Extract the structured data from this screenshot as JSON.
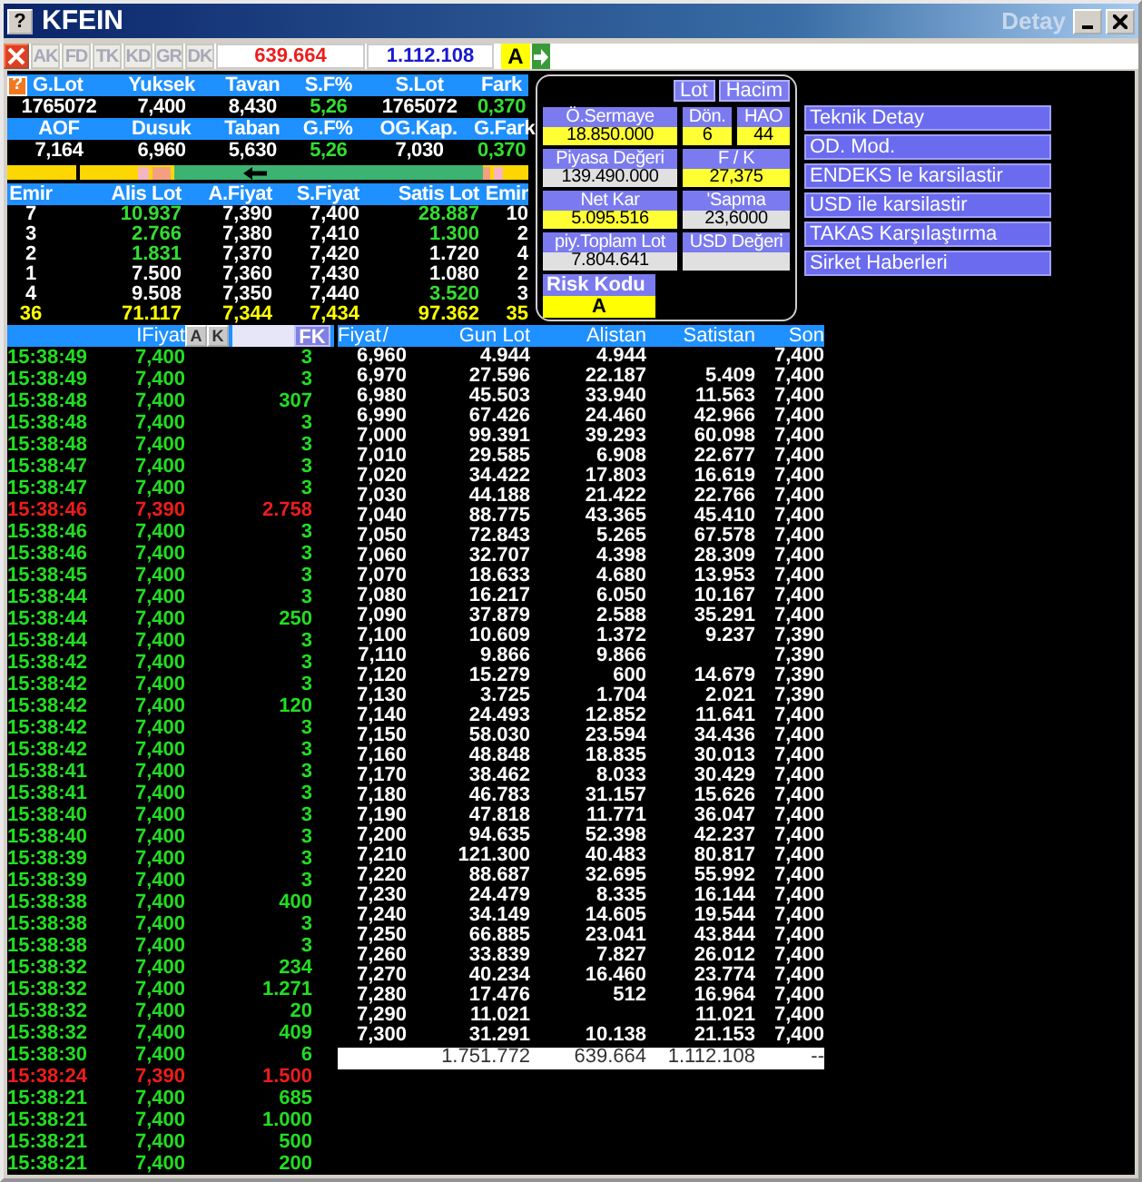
{
  "window": {
    "title": "KFEIN",
    "subtitle": "Detay",
    "help": "?"
  },
  "toolbar": {
    "tabs": [
      {
        "label": "AK",
        "disabled": true
      },
      {
        "label": "FD",
        "disabled": true
      },
      {
        "label": "TK",
        "disabled": true
      },
      {
        "label": "KD",
        "disabled": true
      },
      {
        "label": "GR",
        "disabled": true
      },
      {
        "label": "DK",
        "disabled": true
      }
    ],
    "buy_total": "639.664",
    "sell_total": "1.112.108",
    "risk": "A"
  },
  "stats": {
    "help": "?",
    "rows": [
      {
        "kind": "header",
        "cells": [
          {
            "text": "G.Lot"
          },
          {
            "text": "Yuksek"
          },
          {
            "text": "Tavan"
          },
          {
            "text": "S.F%"
          },
          {
            "text": "S.Lot"
          },
          {
            "text": "Fark"
          }
        ]
      },
      {
        "kind": "values",
        "cells": [
          {
            "text": "1765072",
            "positive": false
          },
          {
            "text": "7,400",
            "positive": false
          },
          {
            "text": "8,430",
            "positive": false
          },
          {
            "text": "5,26",
            "positive": true
          },
          {
            "text": "1765072",
            "positive": false
          },
          {
            "text": "0,370",
            "positive": true
          }
        ]
      },
      {
        "kind": "header",
        "cells": [
          {
            "text": "AOF"
          },
          {
            "text": "Dusuk"
          },
          {
            "text": "Taban"
          },
          {
            "text": "G.F%"
          },
          {
            "text": "OG.Kap."
          },
          {
            "text": "G.Fark"
          }
        ]
      },
      {
        "kind": "values",
        "cells": [
          {
            "text": "7,164",
            "positive": false
          },
          {
            "text": "6,960",
            "positive": false
          },
          {
            "text": "5,630",
            "positive": false
          },
          {
            "text": "5,26",
            "positive": true
          },
          {
            "text": "7,030",
            "positive": false
          },
          {
            "text": "0,370",
            "positive": true
          }
        ]
      }
    ]
  },
  "order_book": {
    "columns": [
      "Emir",
      "Alis Lot",
      "A.Fiyat",
      "S.Fiyat",
      "Satis Lot",
      "Emir"
    ],
    "rows": [
      {
        "bid_orders": "7",
        "bid_lot": "10.937",
        "bid_changed": true,
        "bid": "7,390",
        "ask": "7,400",
        "ask_lot": "28.887",
        "ask_changed": true,
        "ask_orders": "10"
      },
      {
        "bid_orders": "3",
        "bid_lot": "2.766",
        "bid_changed": true,
        "bid": "7,380",
        "ask": "7,410",
        "ask_lot": "1.300",
        "ask_changed": true,
        "ask_orders": "2"
      },
      {
        "bid_orders": "2",
        "bid_lot": "1.831",
        "bid_changed": true,
        "bid": "7,370",
        "ask": "7,420",
        "ask_lot": "1.720",
        "ask_changed": false,
        "ask_orders": "4"
      },
      {
        "bid_orders": "1",
        "bid_lot": "7.500",
        "bid_changed": false,
        "bid": "7,360",
        "ask": "7,430",
        "ask_lot": "1.080",
        "ask_changed": false,
        "ask_orders": "2"
      },
      {
        "bid_orders": "4",
        "bid_lot": "9.508",
        "bid_changed": false,
        "bid": "7,350",
        "ask": "7,440",
        "ask_lot": "3.520",
        "ask_changed": true,
        "ask_orders": "3"
      }
    ],
    "totals": [
      "36",
      "71.117",
      "7,344",
      "7,434",
      "97.362",
      "35"
    ]
  },
  "info_panel": {
    "toggles": [
      {
        "label": "Lot"
      },
      {
        "label": "Hacim"
      }
    ],
    "fields": [
      {
        "label": "Ö.Sermaye",
        "value": "18.850.000",
        "highlight": true
      },
      {
        "label": "Dön.",
        "value": "6",
        "highlight": true
      },
      {
        "label": "HAO",
        "value": "44",
        "highlight": true
      },
      {
        "label": "Piyasa Değeri",
        "value": "139.490.000",
        "highlight": false
      },
      {
        "label": "F / K",
        "value": "27,375",
        "highlight": true
      },
      {
        "label": "Net Kar",
        "value": "5.095.516",
        "highlight": true
      },
      {
        "label": "'Sapma",
        "value": "23,6000",
        "highlight": false
      },
      {
        "label": "piy.Toplam Lot",
        "value": "7.804.641",
        "highlight": false
      },
      {
        "label": "USD Değeri",
        "highlight": false
      }
    ],
    "risk_label": "Risk Kodu",
    "risk_value": "A"
  },
  "actions": [
    "Teknik Detay",
    "OD. Mod.",
    "ENDEKS le karsilastir",
    "USD ile karsilastir",
    "TAKAS Karşılaştırma",
    "Sirket Haberleri"
  ],
  "trades": {
    "header": {
      "price": "IFiyat",
      "buttons": [
        "A",
        "K"
      ],
      "filter": "FK"
    },
    "rows": [
      {
        "time": "15:38:49",
        "price": "7,400",
        "lot": "3",
        "downtick": false
      },
      {
        "time": "15:38:49",
        "price": "7,400",
        "lot": "3",
        "downtick": false
      },
      {
        "time": "15:38:48",
        "price": "7,400",
        "lot": "307",
        "downtick": false
      },
      {
        "time": "15:38:48",
        "price": "7,400",
        "lot": "3",
        "downtick": false
      },
      {
        "time": "15:38:48",
        "price": "7,400",
        "lot": "3",
        "downtick": false
      },
      {
        "time": "15:38:47",
        "price": "7,400",
        "lot": "3",
        "downtick": false
      },
      {
        "time": "15:38:47",
        "price": "7,400",
        "lot": "3",
        "downtick": false
      },
      {
        "time": "15:38:46",
        "price": "7,390",
        "lot": "2.758",
        "downtick": true
      },
      {
        "time": "15:38:46",
        "price": "7,400",
        "lot": "3",
        "downtick": false
      },
      {
        "time": "15:38:46",
        "price": "7,400",
        "lot": "3",
        "downtick": false
      },
      {
        "time": "15:38:45",
        "price": "7,400",
        "lot": "3",
        "downtick": false
      },
      {
        "time": "15:38:44",
        "price": "7,400",
        "lot": "3",
        "downtick": false
      },
      {
        "time": "15:38:44",
        "price": "7,400",
        "lot": "250",
        "downtick": false
      },
      {
        "time": "15:38:44",
        "price": "7,400",
        "lot": "3",
        "downtick": false
      },
      {
        "time": "15:38:42",
        "price": "7,400",
        "lot": "3",
        "downtick": false
      },
      {
        "time": "15:38:42",
        "price": "7,400",
        "lot": "3",
        "downtick": false
      },
      {
        "time": "15:38:42",
        "price": "7,400",
        "lot": "120",
        "downtick": false
      },
      {
        "time": "15:38:42",
        "price": "7,400",
        "lot": "3",
        "downtick": false
      },
      {
        "time": "15:38:42",
        "price": "7,400",
        "lot": "3",
        "downtick": false
      },
      {
        "time": "15:38:41",
        "price": "7,400",
        "lot": "3",
        "downtick": false
      },
      {
        "time": "15:38:41",
        "price": "7,400",
        "lot": "3",
        "downtick": false
      },
      {
        "time": "15:38:40",
        "price": "7,400",
        "lot": "3",
        "downtick": false
      },
      {
        "time": "15:38:40",
        "price": "7,400",
        "lot": "3",
        "downtick": false
      },
      {
        "time": "15:38:39",
        "price": "7,400",
        "lot": "3",
        "downtick": false
      },
      {
        "time": "15:38:39",
        "price": "7,400",
        "lot": "3",
        "downtick": false
      },
      {
        "time": "15:38:38",
        "price": "7,400",
        "lot": "400",
        "downtick": false
      },
      {
        "time": "15:38:38",
        "price": "7,400",
        "lot": "3",
        "downtick": false
      },
      {
        "time": "15:38:38",
        "price": "7,400",
        "lot": "3",
        "downtick": false
      },
      {
        "time": "15:38:32",
        "price": "7,400",
        "lot": "234",
        "downtick": false
      },
      {
        "time": "15:38:32",
        "price": "7,400",
        "lot": "1.271",
        "downtick": false
      },
      {
        "time": "15:38:32",
        "price": "7,400",
        "lot": "20",
        "downtick": false
      },
      {
        "time": "15:38:32",
        "price": "7,400",
        "lot": "409",
        "downtick": false
      },
      {
        "time": "15:38:30",
        "price": "7,400",
        "lot": "6",
        "downtick": false
      },
      {
        "time": "15:38:24",
        "price": "7,390",
        "lot": "1.500",
        "downtick": true
      },
      {
        "time": "15:38:21",
        "price": "7,400",
        "lot": "685",
        "downtick": false
      },
      {
        "time": "15:38:21",
        "price": "7,400",
        "lot": "1.000",
        "downtick": false
      },
      {
        "time": "15:38:21",
        "price": "7,400",
        "lot": "500",
        "downtick": false
      },
      {
        "time": "15:38:21",
        "price": "7,400",
        "lot": "200",
        "downtick": false
      }
    ]
  },
  "price_table": {
    "columns": [
      "Fiyat",
      "Gun Lot",
      "Alistan",
      "Satistan",
      "Son"
    ],
    "sort_mark": "/",
    "rows": [
      {
        "price": "6,960",
        "day_lot": "4.944",
        "bought": "4.944",
        "last": "7,400"
      },
      {
        "price": "6,970",
        "day_lot": "27.596",
        "bought": "22.187",
        "sold": "5.409",
        "last": "7,400"
      },
      {
        "price": "6,980",
        "day_lot": "45.503",
        "bought": "33.940",
        "sold": "11.563",
        "last": "7,400"
      },
      {
        "price": "6,990",
        "day_lot": "67.426",
        "bought": "24.460",
        "sold": "42.966",
        "last": "7,400"
      },
      {
        "price": "7,000",
        "day_lot": "99.391",
        "bought": "39.293",
        "sold": "60.098",
        "last": "7,400"
      },
      {
        "price": "7,010",
        "day_lot": "29.585",
        "bought": "6.908",
        "sold": "22.677",
        "last": "7,400"
      },
      {
        "price": "7,020",
        "day_lot": "34.422",
        "bought": "17.803",
        "sold": "16.619",
        "last": "7,400"
      },
      {
        "price": "7,030",
        "day_lot": "44.188",
        "bought": "21.422",
        "sold": "22.766",
        "last": "7,400"
      },
      {
        "price": "7,040",
        "day_lot": "88.775",
        "bought": "43.365",
        "sold": "45.410",
        "last": "7,400"
      },
      {
        "price": "7,050",
        "day_lot": "72.843",
        "bought": "5.265",
        "sold": "67.578",
        "last": "7,400"
      },
      {
        "price": "7,060",
        "day_lot": "32.707",
        "bought": "4.398",
        "sold": "28.309",
        "last": "7,400"
      },
      {
        "price": "7,070",
        "day_lot": "18.633",
        "bought": "4.680",
        "sold": "13.953",
        "last": "7,400"
      },
      {
        "price": "7,080",
        "day_lot": "16.217",
        "bought": "6.050",
        "sold": "10.167",
        "last": "7,400"
      },
      {
        "price": "7,090",
        "day_lot": "37.879",
        "bought": "2.588",
        "sold": "35.291",
        "last": "7,400"
      },
      {
        "price": "7,100",
        "day_lot": "10.609",
        "bought": "1.372",
        "sold": "9.237",
        "last": "7,390"
      },
      {
        "price": "7,110",
        "day_lot": "9.866",
        "bought": "9.866",
        "last": "7,390"
      },
      {
        "price": "7,120",
        "day_lot": "15.279",
        "bought": "600",
        "sold": "14.679",
        "last": "7,390"
      },
      {
        "price": "7,130",
        "day_lot": "3.725",
        "bought": "1.704",
        "sold": "2.021",
        "last": "7,390"
      },
      {
        "price": "7,140",
        "day_lot": "24.493",
        "bought": "12.852",
        "sold": "11.641",
        "last": "7,400"
      },
      {
        "price": "7,150",
        "day_lot": "58.030",
        "bought": "23.594",
        "sold": "34.436",
        "last": "7,400"
      },
      {
        "price": "7,160",
        "day_lot": "48.848",
        "bought": "18.835",
        "sold": "30.013",
        "last": "7,400"
      },
      {
        "price": "7,170",
        "day_lot": "38.462",
        "bought": "8.033",
        "sold": "30.429",
        "last": "7,400"
      },
      {
        "price": "7,180",
        "day_lot": "46.783",
        "bought": "31.157",
        "sold": "15.626",
        "last": "7,400"
      },
      {
        "price": "7,190",
        "day_lot": "47.818",
        "bought": "11.771",
        "sold": "36.047",
        "last": "7,400"
      },
      {
        "price": "7,200",
        "day_lot": "94.635",
        "bought": "52.398",
        "sold": "42.237",
        "last": "7,400"
      },
      {
        "price": "7,210",
        "day_lot": "121.300",
        "bought": "40.483",
        "sold": "80.817",
        "last": "7,400"
      },
      {
        "price": "7,220",
        "day_lot": "88.687",
        "bought": "32.695",
        "sold": "55.992",
        "last": "7,400"
      },
      {
        "price": "7,230",
        "day_lot": "24.479",
        "bought": "8.335",
        "sold": "16.144",
        "last": "7,400"
      },
      {
        "price": "7,240",
        "day_lot": "34.149",
        "bought": "14.605",
        "sold": "19.544",
        "last": "7,400"
      },
      {
        "price": "7,250",
        "day_lot": "66.885",
        "bought": "23.041",
        "sold": "43.844",
        "last": "7,400"
      },
      {
        "price": "7,260",
        "day_lot": "33.839",
        "bought": "7.827",
        "sold": "26.012",
        "last": "7,400"
      },
      {
        "price": "7,270",
        "day_lot": "40.234",
        "bought": "16.460",
        "sold": "23.774",
        "last": "7,400"
      },
      {
        "price": "7,280",
        "day_lot": "17.476",
        "bought": "512",
        "sold": "16.964",
        "last": "7,400"
      },
      {
        "price": "7,290",
        "day_lot": "11.021",
        "sold": "11.021",
        "last": "7,400"
      },
      {
        "price": "7,300",
        "day_lot": "31.291",
        "bought": "10.138",
        "sold": "21.153",
        "last": "7,400"
      }
    ],
    "totals": {
      "day_lot": "1.751.772",
      "bought": "639.664",
      "sold": "1.112.108",
      "last": "--"
    }
  }
}
